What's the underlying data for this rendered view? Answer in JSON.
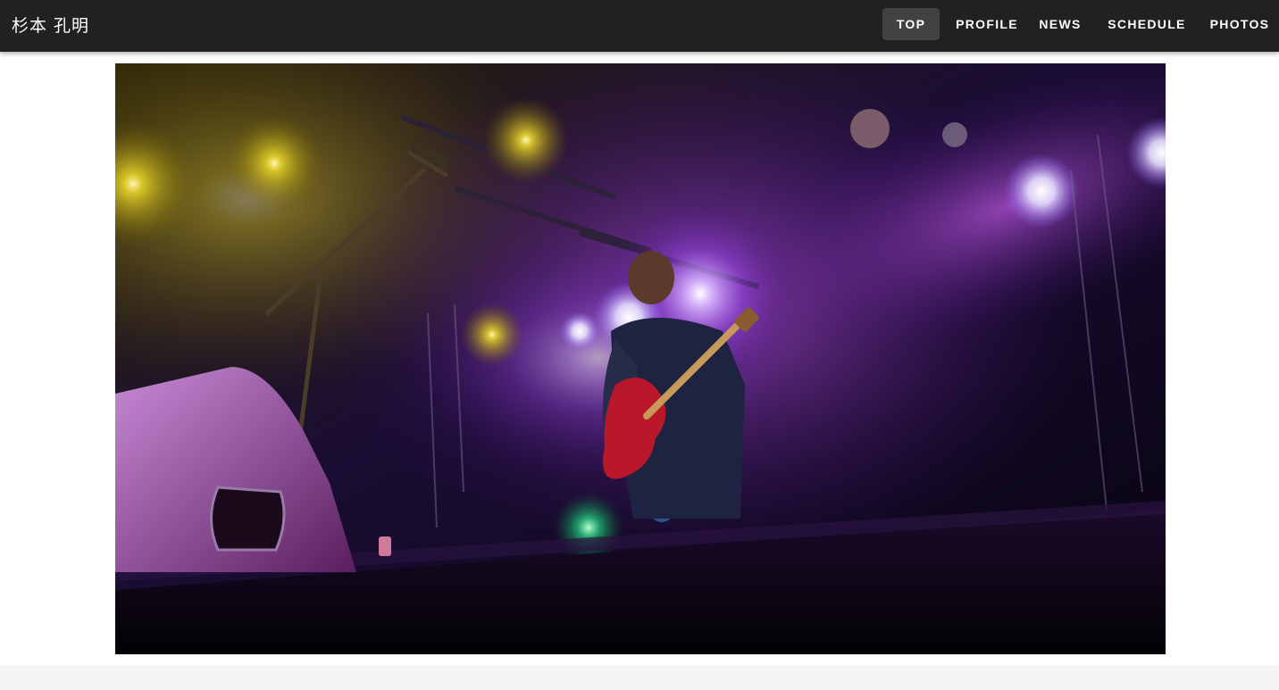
{
  "header": {
    "site_title": "杉本 孔明",
    "nav": [
      {
        "label": "TOP",
        "active": true
      },
      {
        "label": "PROFILE",
        "active": false
      },
      {
        "label": "NEWS",
        "active": false
      },
      {
        "label": "SCHEDULE",
        "active": false
      },
      {
        "label": "PHOTOS",
        "active": false
      }
    ]
  },
  "hero": {
    "image": "live-performance-photo"
  },
  "colors": {
    "header_bg": "#212121",
    "active_nav_bg": "#424242",
    "page_bg": "#ffffff",
    "footer_bg": "#f5f5f5"
  }
}
